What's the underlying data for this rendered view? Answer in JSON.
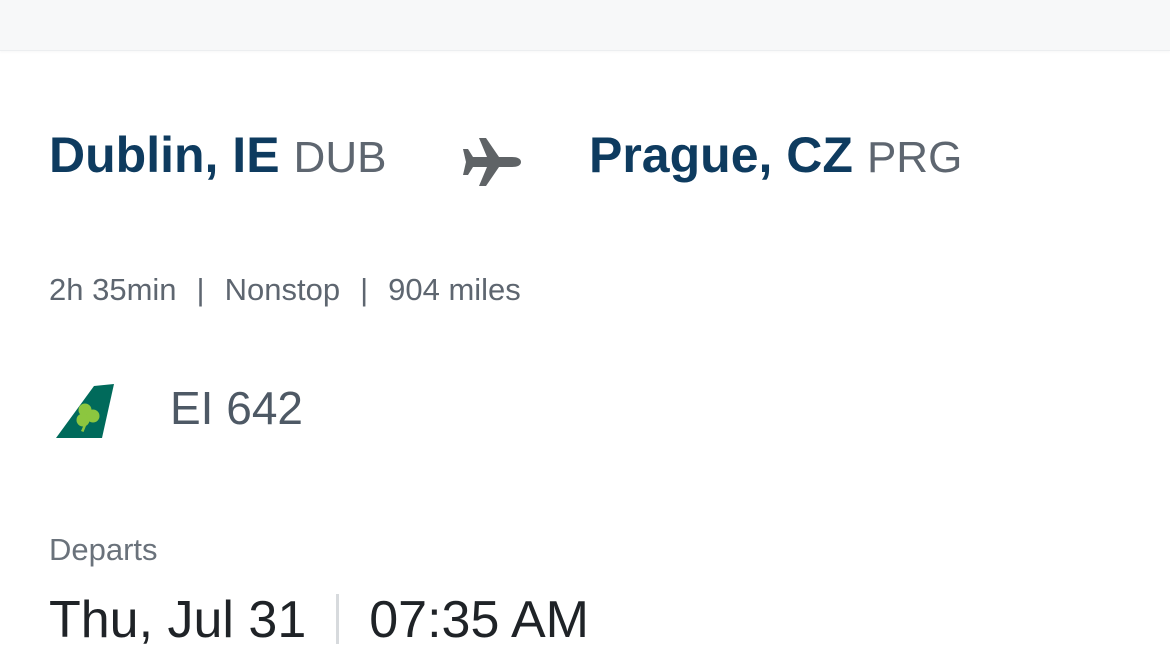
{
  "route": {
    "origin": {
      "city": "Dublin, IE",
      "code": "DUB"
    },
    "destination": {
      "city": "Prague, CZ",
      "code": "PRG"
    },
    "route_icon": "airplane-icon"
  },
  "flight_info": {
    "duration": "2h 35min",
    "stops": "Nonstop",
    "distance": "904 miles",
    "separator": "|"
  },
  "flight": {
    "airline_logo": "aer-lingus-tail-logo",
    "number": "EI 642"
  },
  "departure": {
    "label": "Departs",
    "date": "Thu, Jul 31",
    "time": "07:35 AM"
  },
  "colors": {
    "city_text": "#0e3b5f",
    "secondary_text": "#5e6670",
    "primary_text": "#1f2327",
    "logo_teal": "#006a5b",
    "logo_shamrock": "#8cc63f"
  }
}
